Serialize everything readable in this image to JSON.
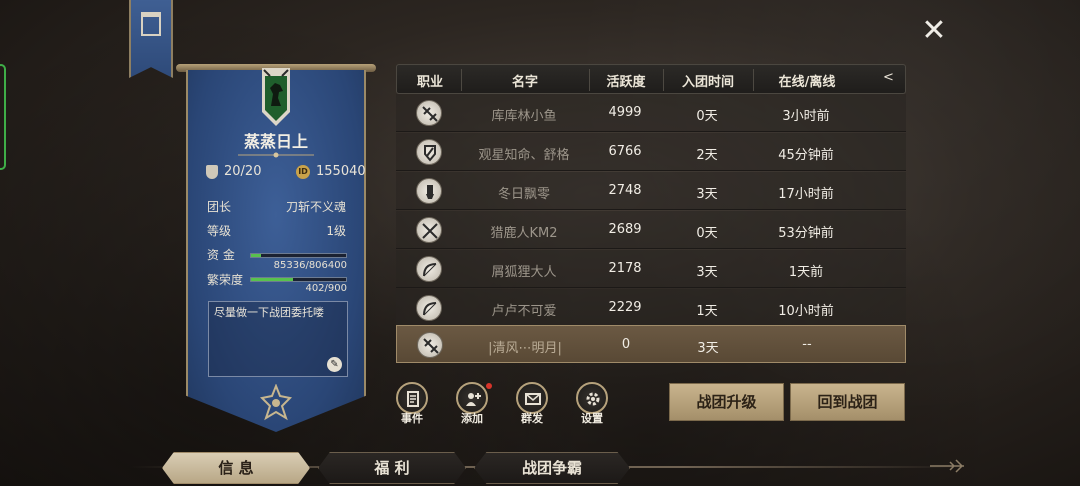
{
  "close": {
    "symbol": "✕"
  },
  "guild": {
    "name": "蒸蒸日上",
    "members": "20/20",
    "id_badge": "ID",
    "id": "155040",
    "leader_label": "团长",
    "leader": "刀斩不义魂",
    "level_label": "等级",
    "level": "1级",
    "funds_label": "资  金",
    "funds_text": "85336/806400",
    "funds_fraction": 0.106,
    "prosperity_label": "繁荣度",
    "prosperity_text": "402/900",
    "prosperity_fraction": 0.447,
    "notice": "尽量做一下战团委托喽",
    "edit_symbol": "✎"
  },
  "table": {
    "headers": [
      "职业",
      "名字",
      "活跃度",
      "入团时间",
      "在线/离线"
    ],
    "collapse_symbol": "<",
    "rows": [
      {
        "class_icon": "crossbow-icon",
        "name": "库库林小鱼",
        "activity": "4999",
        "joined": "0天",
        "status": "3小时前"
      },
      {
        "class_icon": "shield-icon",
        "name": "观星知命、舒格",
        "activity": "6766",
        "joined": "2天",
        "status": "45分钟前"
      },
      {
        "class_icon": "gauntlet-icon",
        "name": "冬日飘零",
        "activity": "2748",
        "joined": "3天",
        "status": "17小时前"
      },
      {
        "class_icon": "crossed-swords-icon",
        "name": "猎鹿人KM2",
        "activity": "2689",
        "joined": "0天",
        "status": "53分钟前"
      },
      {
        "class_icon": "bow-icon",
        "name": "屑狐狸大人",
        "activity": "2178",
        "joined": "3天",
        "status": "1天前"
      },
      {
        "class_icon": "bow-icon",
        "name": "卢卢不可爱",
        "activity": "2229",
        "joined": "1天",
        "status": "10小时前"
      },
      {
        "class_icon": "crossbow-icon",
        "name": "|清风⋯明月|",
        "activity": "0",
        "joined": "3天",
        "status": "--",
        "selected": true
      }
    ]
  },
  "actions": {
    "events": "事件",
    "add": "添加",
    "broadcast": "群发",
    "settings": "设置"
  },
  "buttons": {
    "upgrade": "战团升级",
    "return": "回到战团"
  },
  "tabs": [
    "信 息",
    "福 利",
    "战团争霸"
  ],
  "colors": {
    "banner_blue": "#2a4676",
    "accent_gold": "#b6a27c",
    "progress_green": "#58c24d",
    "notify_red": "#d7342a"
  }
}
